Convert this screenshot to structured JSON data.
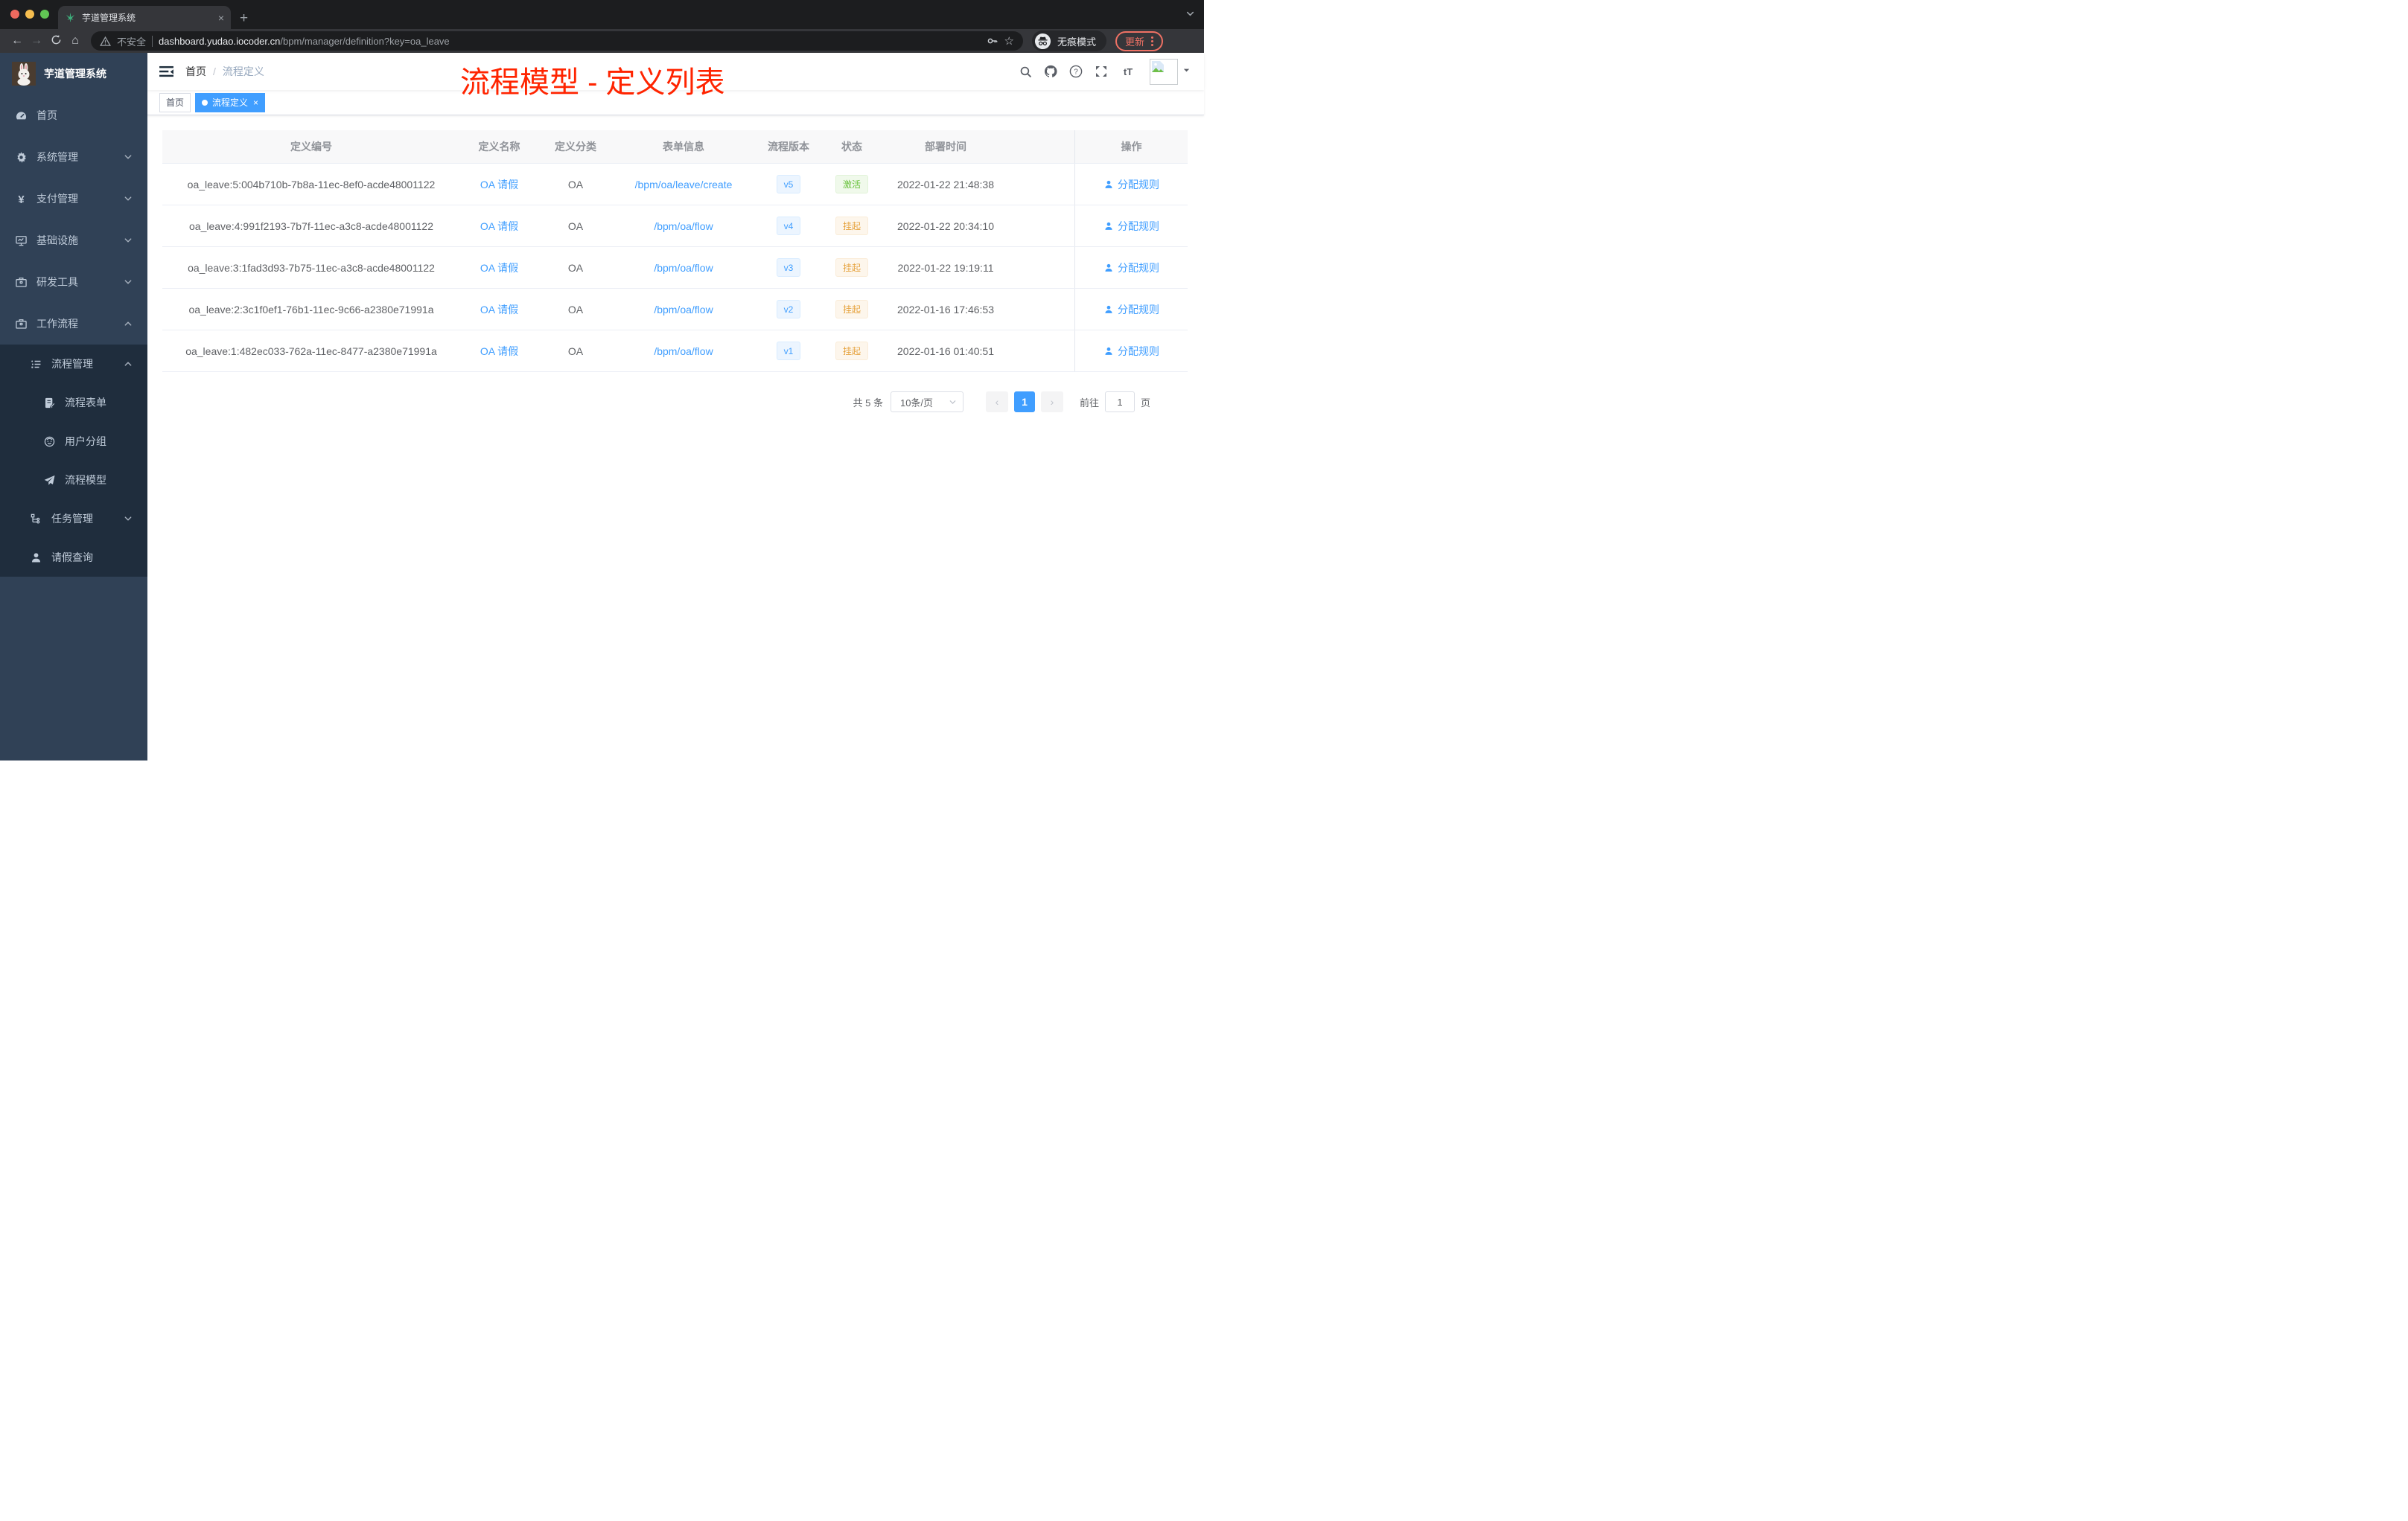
{
  "browser": {
    "tab_title": "芋道管理系统",
    "security_label": "不安全",
    "url_host": "dashboard.yudao.iocoder.cn",
    "url_path": "/bpm/manager/definition?key=oa_leave",
    "incognito_label": "无痕模式",
    "update_label": "更新"
  },
  "sidebar": {
    "logo_title": "芋道管理系统",
    "items": [
      {
        "label": "首页",
        "icon": "gauge-icon",
        "level": 1,
        "chevron": "",
        "submenu": false
      },
      {
        "label": "系统管理",
        "icon": "gear-icon",
        "level": 1,
        "chevron": "down",
        "submenu": false
      },
      {
        "label": "支付管理",
        "icon": "yen-icon",
        "level": 1,
        "chevron": "down",
        "submenu": false
      },
      {
        "label": "基础设施",
        "icon": "monitor-icon",
        "level": 1,
        "chevron": "down",
        "submenu": false
      },
      {
        "label": "研发工具",
        "icon": "briefcase-icon",
        "level": 1,
        "chevron": "down",
        "submenu": false
      },
      {
        "label": "工作流程",
        "icon": "briefcase-icon",
        "level": 1,
        "chevron": "up",
        "submenu": false
      },
      {
        "label": "流程管理",
        "icon": "list-icon",
        "level": 2,
        "chevron": "up",
        "submenu": true
      },
      {
        "label": "流程表单",
        "icon": "form-icon",
        "level": 3,
        "chevron": "",
        "submenu": true
      },
      {
        "label": "用户分组",
        "icon": "group-icon",
        "level": 3,
        "chevron": "",
        "submenu": true
      },
      {
        "label": "流程模型",
        "icon": "send-icon",
        "level": 3,
        "chevron": "",
        "submenu": true
      },
      {
        "label": "任务管理",
        "icon": "tree-icon",
        "level": 2,
        "chevron": "down",
        "submenu": true
      },
      {
        "label": "请假查询",
        "icon": "user-icon",
        "level": 2,
        "chevron": "",
        "submenu": true
      }
    ]
  },
  "navbar": {
    "breadcrumb": [
      "首页",
      "流程定义"
    ],
    "breadcrumb_separator": "/",
    "annotation": "流程模型 - 定义列表",
    "font_icon_text": "tT",
    "help_icon_text": "?"
  },
  "tags": [
    {
      "label": "首页",
      "active": false,
      "closable": false
    },
    {
      "label": "流程定义",
      "active": true,
      "closable": true
    }
  ],
  "table": {
    "columns": [
      "定义编号",
      "定义名称",
      "定义分类",
      "表单信息",
      "流程版本",
      "状态",
      "部署时间",
      "操作"
    ],
    "rows": [
      {
        "id": "oa_leave:5:004b710b-7b8a-11ec-8ef0-acde48001122",
        "name": "OA 请假",
        "category": "OA",
        "form": "/bpm/oa/leave/create",
        "version": "v5",
        "status": "激活",
        "status_kind": "success",
        "deploy_time": "2022-01-22 21:48:38",
        "action": "分配规则"
      },
      {
        "id": "oa_leave:4:991f2193-7b7f-11ec-a3c8-acde48001122",
        "name": "OA 请假",
        "category": "OA",
        "form": "/bpm/oa/flow",
        "version": "v4",
        "status": "挂起",
        "status_kind": "warning",
        "deploy_time": "2022-01-22 20:34:10",
        "action": "分配规则"
      },
      {
        "id": "oa_leave:3:1fad3d93-7b75-11ec-a3c8-acde48001122",
        "name": "OA 请假",
        "category": "OA",
        "form": "/bpm/oa/flow",
        "version": "v3",
        "status": "挂起",
        "status_kind": "warning",
        "deploy_time": "2022-01-22 19:19:11",
        "action": "分配规则"
      },
      {
        "id": "oa_leave:2:3c1f0ef1-76b1-11ec-9c66-a2380e71991a",
        "name": "OA 请假",
        "category": "OA",
        "form": "/bpm/oa/flow",
        "version": "v2",
        "status": "挂起",
        "status_kind": "warning",
        "deploy_time": "2022-01-16 17:46:53",
        "action": "分配规则"
      },
      {
        "id": "oa_leave:1:482ec033-762a-11ec-8477-a2380e71991a",
        "name": "OA 请假",
        "category": "OA",
        "form": "/bpm/oa/flow",
        "version": "v1",
        "status": "挂起",
        "status_kind": "warning",
        "deploy_time": "2022-01-16 01:40:51",
        "action": "分配规则"
      }
    ]
  },
  "pagination": {
    "total_label": "共 5 条",
    "page_size_label": "10条/页",
    "current_page": "1",
    "goto_label": "前往",
    "goto_value": "1",
    "page_unit": "页"
  },
  "colors": {
    "accent": "#409eff",
    "success": "#67c23a",
    "warning": "#e6a23c",
    "annotation": "#ff2400",
    "sidebar-bg": "#304156",
    "submenu-bg": "#1f2d3d",
    "update-accent": "#ee7164"
  }
}
